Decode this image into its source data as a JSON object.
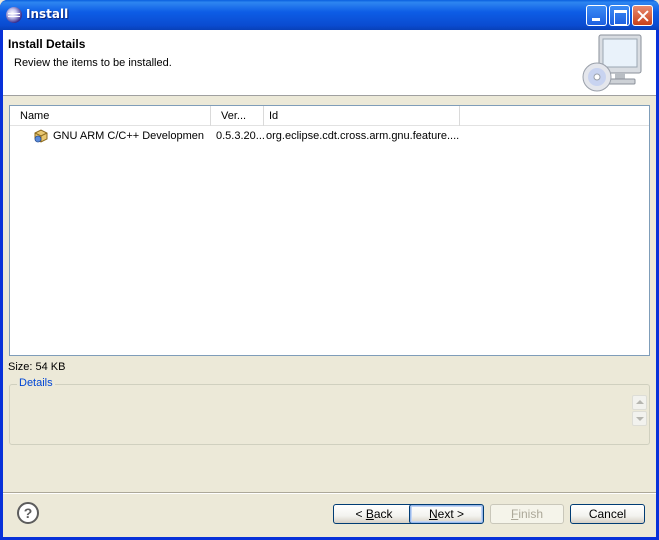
{
  "window": {
    "title": "Install"
  },
  "banner": {
    "title": "Install Details",
    "subtitle": "Review the items to be installed."
  },
  "table": {
    "columns": [
      "Name",
      "Ver...",
      "Id"
    ],
    "rows": [
      {
        "name": "GNU ARM C/C++ Developmen",
        "version": "0.5.3.20...",
        "id": "org.eclipse.cdt.cross.arm.gnu.feature...."
      }
    ]
  },
  "size_label": "Size: 54 KB",
  "details": {
    "label": "Details"
  },
  "buttons": {
    "back_prefix": "< ",
    "back_key": "B",
    "back_rest": "ack",
    "next_key": "N",
    "next_rest": "ext >",
    "finish_key": "F",
    "finish_rest": "inish",
    "cancel": "Cancel",
    "help": "?"
  },
  "colors": {
    "titlebar": "#0D5DE6",
    "dialog_bg": "#ECE9D8",
    "group_label": "#0046D5",
    "disabled_text": "#ACA899"
  }
}
